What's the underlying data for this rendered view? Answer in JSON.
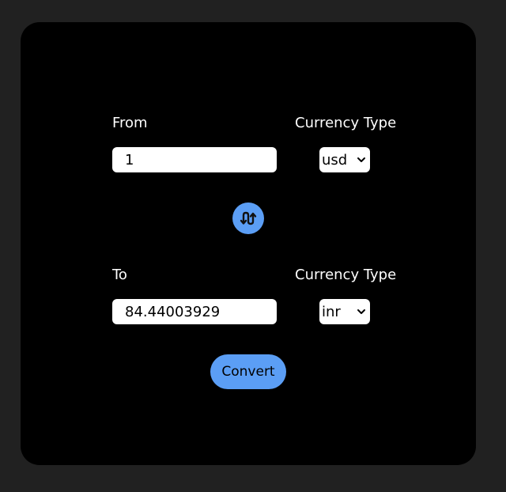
{
  "from": {
    "label": "From",
    "amount": "1",
    "currency_label": "Currency Type",
    "currency": "usd"
  },
  "to": {
    "label": "To",
    "amount": "84.44003929",
    "currency_label": "Currency Type",
    "currency": "inr"
  },
  "actions": {
    "swap_icon": "swap-arrows-icon",
    "convert_label": "Convert"
  },
  "colors": {
    "page_background": "#212121",
    "card_background": "#000000",
    "accent": "#5b9ef5",
    "text": "#ffffff"
  }
}
